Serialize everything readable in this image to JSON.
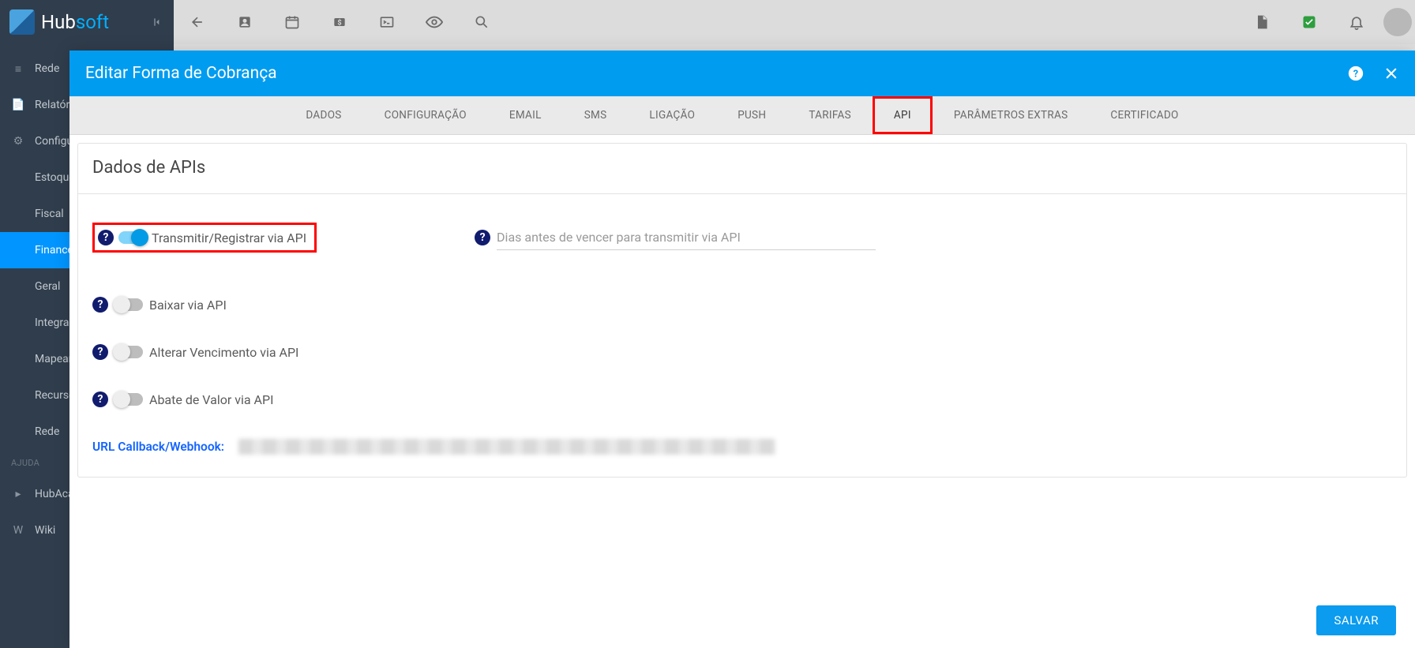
{
  "app": {
    "logo_hub": "Hub",
    "logo_soft": "soft"
  },
  "sidebar": {
    "items": [
      {
        "label": "Rede"
      },
      {
        "label": "Relatório"
      },
      {
        "label": "Configur"
      },
      {
        "label": "Estoque"
      },
      {
        "label": "Fiscal"
      },
      {
        "label": "Financei"
      },
      {
        "label": "Geral"
      },
      {
        "label": "Integraçã"
      },
      {
        "label": "Mapeam"
      },
      {
        "label": "Recursos"
      },
      {
        "label": "Rede"
      }
    ],
    "section_label": "AJUDA",
    "help_items": [
      {
        "label": "HubAcad"
      },
      {
        "label": "Wiki"
      }
    ]
  },
  "modal": {
    "title": "Editar Forma de Cobrança",
    "tabs": [
      "DADOS",
      "CONFIGURAÇÃO",
      "EMAIL",
      "SMS",
      "LIGAÇÃO",
      "PUSH",
      "TARIFAS",
      "API",
      "PARÂMETROS EXTRAS",
      "CERTIFICADO"
    ],
    "panel_title": "Dados de APIs",
    "toggle_transmit": "Transmitir/Registrar via API",
    "input_days_placeholder": "Dias antes de vencer para transmitir via API",
    "toggle_baixar": "Baixar via API",
    "toggle_vencimento": "Alterar Vencimento via API",
    "toggle_abate": "Abate de Valor via API",
    "callback_label": "URL Callback/Webhook:",
    "save": "SALVAR"
  }
}
